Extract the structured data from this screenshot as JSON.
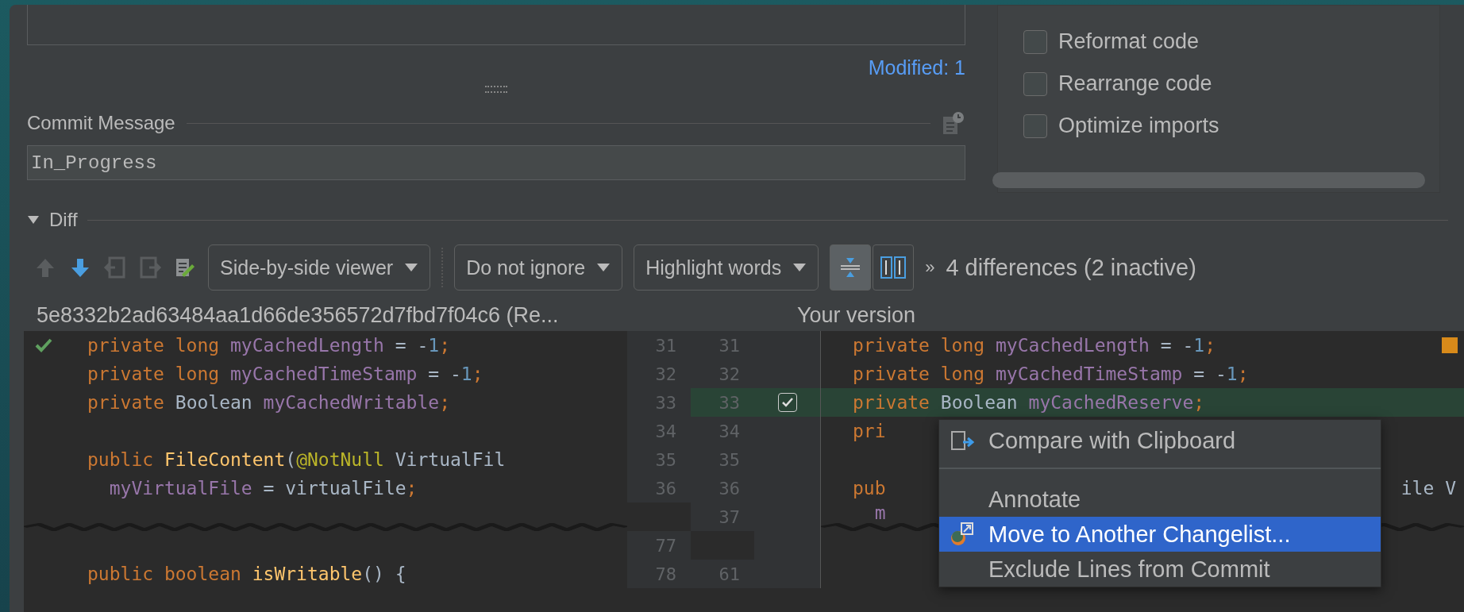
{
  "changes": {
    "modified": "Modified: 1"
  },
  "commit_message": {
    "label": "Commit Message",
    "value": "In_Progress"
  },
  "options": [
    {
      "label": "Reformat code",
      "checked": false
    },
    {
      "label": "Rearrange code",
      "checked": false
    },
    {
      "label": "Optimize imports",
      "checked": false
    }
  ],
  "diff": {
    "title": "Diff",
    "expanded": true,
    "toolbar": {
      "dropdowns": [
        "Side-by-side viewer",
        "Do not ignore",
        "Highlight words"
      ],
      "toggles": [
        {
          "kind": "collapse",
          "on": true
        },
        {
          "kind": "sync",
          "on": false
        }
      ],
      "more": "»",
      "summary": "4 differences (2 inactive)"
    },
    "left_title": "5e8332b2ad63484aa1d66de356572d7fbd7f04c6 (Re...",
    "right_title": "Your version",
    "rows": [
      {
        "kind": "line",
        "accepted": true,
        "left_no": "31",
        "right_no": "31",
        "changed": false,
        "left": [
          {
            "t": "private long ",
            "kind": "keyword"
          },
          {
            "t": "myCachedLength",
            "kind": "field"
          },
          {
            "t": " = -",
            "kind": "plain"
          },
          {
            "t": "1",
            "kind": "number"
          },
          {
            "t": ";",
            "kind": "keyword"
          }
        ],
        "right": [
          {
            "t": "private long ",
            "kind": "keyword"
          },
          {
            "t": "myCachedLength",
            "kind": "field"
          },
          {
            "t": " = -",
            "kind": "plain"
          },
          {
            "t": "1",
            "kind": "number"
          },
          {
            "t": ";",
            "kind": "keyword"
          }
        ]
      },
      {
        "kind": "line",
        "left_no": "32",
        "right_no": "32",
        "changed": false,
        "left": [
          {
            "t": "private long ",
            "kind": "keyword"
          },
          {
            "t": "myCachedTimeStamp",
            "kind": "field"
          },
          {
            "t": " = -",
            "kind": "plain"
          },
          {
            "t": "1",
            "kind": "number"
          },
          {
            "t": ";",
            "kind": "keyword"
          }
        ],
        "right": [
          {
            "t": "private long ",
            "kind": "keyword"
          },
          {
            "t": "myCachedTimeStamp",
            "kind": "field"
          },
          {
            "t": " = -",
            "kind": "plain"
          },
          {
            "t": "1",
            "kind": "number"
          },
          {
            "t": ";",
            "kind": "keyword"
          }
        ]
      },
      {
        "kind": "line",
        "left_no": "33",
        "right_no": "33",
        "changed": true,
        "included": true,
        "left": [
          {
            "t": "private ",
            "kind": "keyword"
          },
          {
            "t": "Boolean ",
            "kind": "plain"
          },
          {
            "t": "myCachedWritable",
            "kind": "field"
          },
          {
            "t": ";",
            "kind": "keyword"
          }
        ],
        "right": [
          {
            "t": "private ",
            "kind": "keyword"
          },
          {
            "t": "Boolean ",
            "kind": "plain"
          },
          {
            "t": "myCachedReserve",
            "kind": "field"
          },
          {
            "t": ";",
            "kind": "keyword"
          }
        ]
      },
      {
        "kind": "line",
        "left_no": "34",
        "right_no": "34",
        "changed": false,
        "left": [],
        "right": [
          {
            "t": "pri",
            "kind": "keyword"
          }
        ]
      },
      {
        "kind": "line",
        "left_no": "35",
        "right_no": "35",
        "changed": false,
        "left": [
          {
            "t": "public ",
            "kind": "keyword"
          },
          {
            "t": "FileContent",
            "kind": "method"
          },
          {
            "t": "(",
            "kind": "plain"
          },
          {
            "t": "@NotNull",
            "kind": "annotation"
          },
          {
            "t": " VirtualFil",
            "kind": "plain"
          }
        ],
        "right": []
      },
      {
        "kind": "line",
        "left_no": "36",
        "right_no": "36",
        "changed": false,
        "left": [
          {
            "t": "  myVirtualFile",
            "kind": "field"
          },
          {
            "t": " = virtualFile",
            "kind": "plain"
          },
          {
            "t": ";",
            "kind": "keyword"
          }
        ],
        "right": [
          {
            "t": "pub",
            "kind": "keyword"
          }
        ],
        "right_tail": "ile V"
      },
      {
        "kind": "fold",
        "left_no": "",
        "right_no": "37",
        "changed": false,
        "left": [],
        "right": [
          {
            "t": "  m",
            "kind": "field"
          }
        ]
      },
      {
        "kind": "line",
        "left_no": "77",
        "right_no": "",
        "changed": false,
        "left": [],
        "right": []
      },
      {
        "kind": "line",
        "left_no": "78",
        "right_no": "61",
        "changed": false,
        "left": [
          {
            "t": "public boolean ",
            "kind": "keyword"
          },
          {
            "t": "isWritable",
            "kind": "method"
          },
          {
            "t": "() {",
            "kind": "plain"
          }
        ],
        "right": []
      }
    ]
  },
  "context_menu": [
    {
      "label": "Compare with Clipboard",
      "selected": false,
      "separator_after": true
    },
    {
      "label": "Annotate",
      "selected": false
    },
    {
      "label": "Move to Another Changelist...",
      "selected": true
    },
    {
      "label": "Exclude Lines from Commit",
      "selected": false
    }
  ]
}
